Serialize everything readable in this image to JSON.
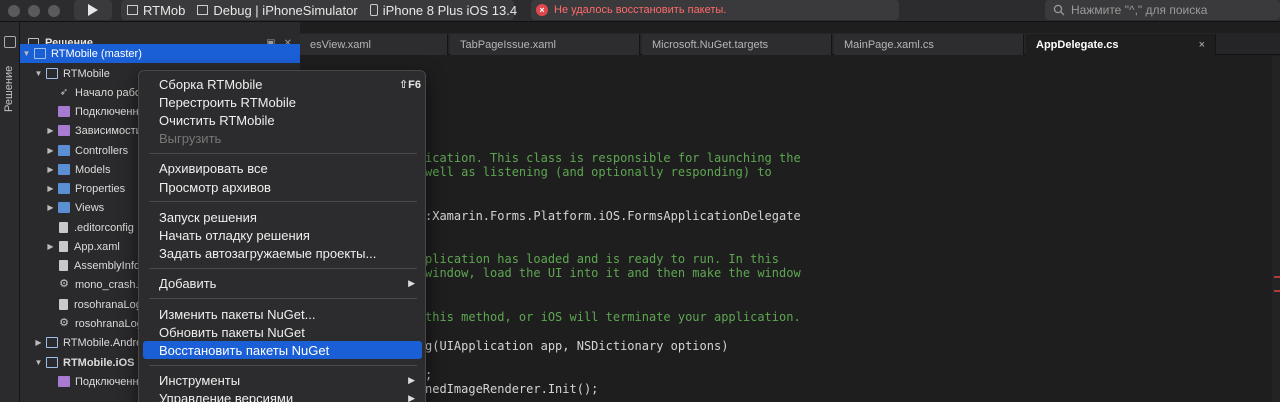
{
  "toolbar": {
    "run_icon": "play-icon",
    "config": [
      "RTMob",
      "Debug | iPhoneSimulator",
      "iPhone 8 Plus iOS 13.4"
    ],
    "status_message": "Не удалось восстановить пакеты.",
    "search_placeholder": "Нажмите \"^,\" для поиска"
  },
  "left_strip": {
    "label": "Решение"
  },
  "solution": {
    "title": "Решение",
    "tree": [
      {
        "label": "RTMobile (master)",
        "indent": 0,
        "arrow": "▼",
        "icon": "proj",
        "selected": true
      },
      {
        "label": "RTMobile",
        "indent": 1,
        "arrow": "▼",
        "icon": "proj"
      },
      {
        "label": "Начало работы",
        "indent": 2,
        "arrow": "",
        "icon": "rocket"
      },
      {
        "label": "Подключенные службы",
        "indent": 2,
        "arrow": "",
        "icon": "purple"
      },
      {
        "label": "Зависимости",
        "indent": 2,
        "arrow": "▶",
        "icon": "purple"
      },
      {
        "label": "Controllers",
        "indent": 2,
        "arrow": "▶",
        "icon": "folder"
      },
      {
        "label": "Models",
        "indent": 2,
        "arrow": "▶",
        "icon": "folder"
      },
      {
        "label": "Properties",
        "indent": 2,
        "arrow": "▶",
        "icon": "folder"
      },
      {
        "label": "Views",
        "indent": 2,
        "arrow": "▶",
        "icon": "folder"
      },
      {
        "label": ".editorconfig",
        "indent": 2,
        "arrow": "",
        "icon": "file"
      },
      {
        "label": "App.xaml",
        "indent": 2,
        "arrow": "▶",
        "icon": "file"
      },
      {
        "label": "AssemblyInfo.cs",
        "indent": 2,
        "arrow": "",
        "icon": "file"
      },
      {
        "label": "mono_crash.",
        "indent": 2,
        "arrow": "",
        "icon": "gear"
      },
      {
        "label": "rosohranaLog",
        "indent": 2,
        "arrow": "",
        "icon": "file"
      },
      {
        "label": "rosohranaLog",
        "indent": 2,
        "arrow": "",
        "icon": "gear"
      },
      {
        "label": "RTMobile.Android",
        "indent": 1,
        "arrow": "▶",
        "icon": "proj"
      },
      {
        "label": "RTMobile.iOS",
        "indent": 1,
        "arrow": "▼",
        "icon": "proj",
        "bold": true
      },
      {
        "label": "Подключенные службы",
        "indent": 2,
        "arrow": "",
        "icon": "purple"
      }
    ]
  },
  "tabs": [
    {
      "label": "esView.xaml",
      "active": false
    },
    {
      "label": "TabPageIssue.xaml",
      "active": false
    },
    {
      "label": "Microsoft.NuGet.targets",
      "active": false
    },
    {
      "label": "MainPage.xaml.cs",
      "active": false
    },
    {
      "label": "AppDelegate.cs",
      "active": true
    }
  ],
  "editor": {
    "lines": [
      {
        "text": "ication. This class is responsible for launching the",
        "cls": "cm"
      },
      {
        "text": "well as listening (and optionally responding) to",
        "cls": "cm"
      },
      {
        "text": ":Xamarin.Forms.Platform.iOS.FormsApplicationDelegate",
        "cls": "ty"
      },
      {
        "text": "plication has loaded and is ready to run. In this",
        "cls": "cm"
      },
      {
        "text": "window, load the UI into it and then make the window",
        "cls": "cm"
      },
      {
        "text": "this method, or iOS will terminate your application.",
        "cls": "cm"
      },
      {
        "text": "g(UIApplication app, NSDictionary options)",
        "cls": "ty"
      },
      {
        "text": ";",
        "cls": "ty"
      },
      {
        "text": "nedImageRenderer.Init();",
        "cls": "ty"
      }
    ]
  },
  "context_menu": {
    "items": [
      {
        "label": "Сборка RTMobile",
        "shortcut": "⇧F6"
      },
      {
        "label": "Перестроить RTMobile"
      },
      {
        "label": "Очистить RTMobile"
      },
      {
        "label": "Выгрузить",
        "disabled": true
      },
      {
        "separator": true
      },
      {
        "label": "Архивировать все"
      },
      {
        "label": "Просмотр архивов"
      },
      {
        "separator": true
      },
      {
        "label": "Запуск решения"
      },
      {
        "label": "Начать отладку решения"
      },
      {
        "label": "Задать автозагружаемые проекты..."
      },
      {
        "separator": true
      },
      {
        "label": "Добавить",
        "submenu": true
      },
      {
        "separator": true
      },
      {
        "label": "Изменить пакеты NuGet..."
      },
      {
        "label": "Обновить пакеты NuGet"
      },
      {
        "label": "Восстановить пакеты NuGet",
        "highlight": true
      },
      {
        "separator": true
      },
      {
        "label": "Инструменты",
        "submenu": true
      },
      {
        "label": "Управление версиями",
        "submenu": true
      }
    ]
  },
  "colors": {
    "selection": "#1b5fd6",
    "comment": "#5ea652",
    "error": "#ff6b6b"
  }
}
